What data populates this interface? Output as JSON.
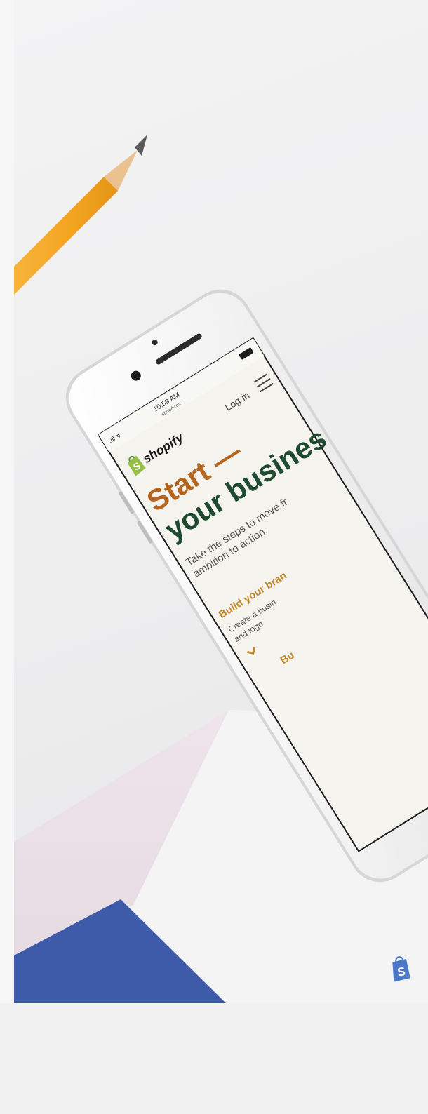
{
  "colors": {
    "pencil_yellow": "#f5a623",
    "pencil_wood": "#e9c28f",
    "lead": "#5a5a5a",
    "phone_body": "#f7f7f7",
    "screen_bg": "#f4f3ee",
    "brand_green": "#95bf47",
    "headline_orange": "#b5651d",
    "headline_green": "#1e4b2f",
    "envelope_pink": "#ecdfe6",
    "envelope_blue": "#3d5ba9"
  },
  "phone": {
    "status_time": "10:59 AM",
    "url": "shopify.ca",
    "login_label": "Log in",
    "brand_name": "shopify",
    "headline_line1": "Start —",
    "headline_line2": "your busines",
    "subtitle_line1": "Take the steps to move fr",
    "subtitle_line2": "ambition to action.",
    "section_title": "Build your bran",
    "section_text_line1": "Create a busin",
    "section_text_line2": "and logo",
    "next_item": "Bu"
  },
  "icons": {
    "menu": "hamburger-icon",
    "brand": "shopify-bag-icon",
    "expand": "chevron-down-icon",
    "envelope_brand": "shopify-bag-icon"
  }
}
